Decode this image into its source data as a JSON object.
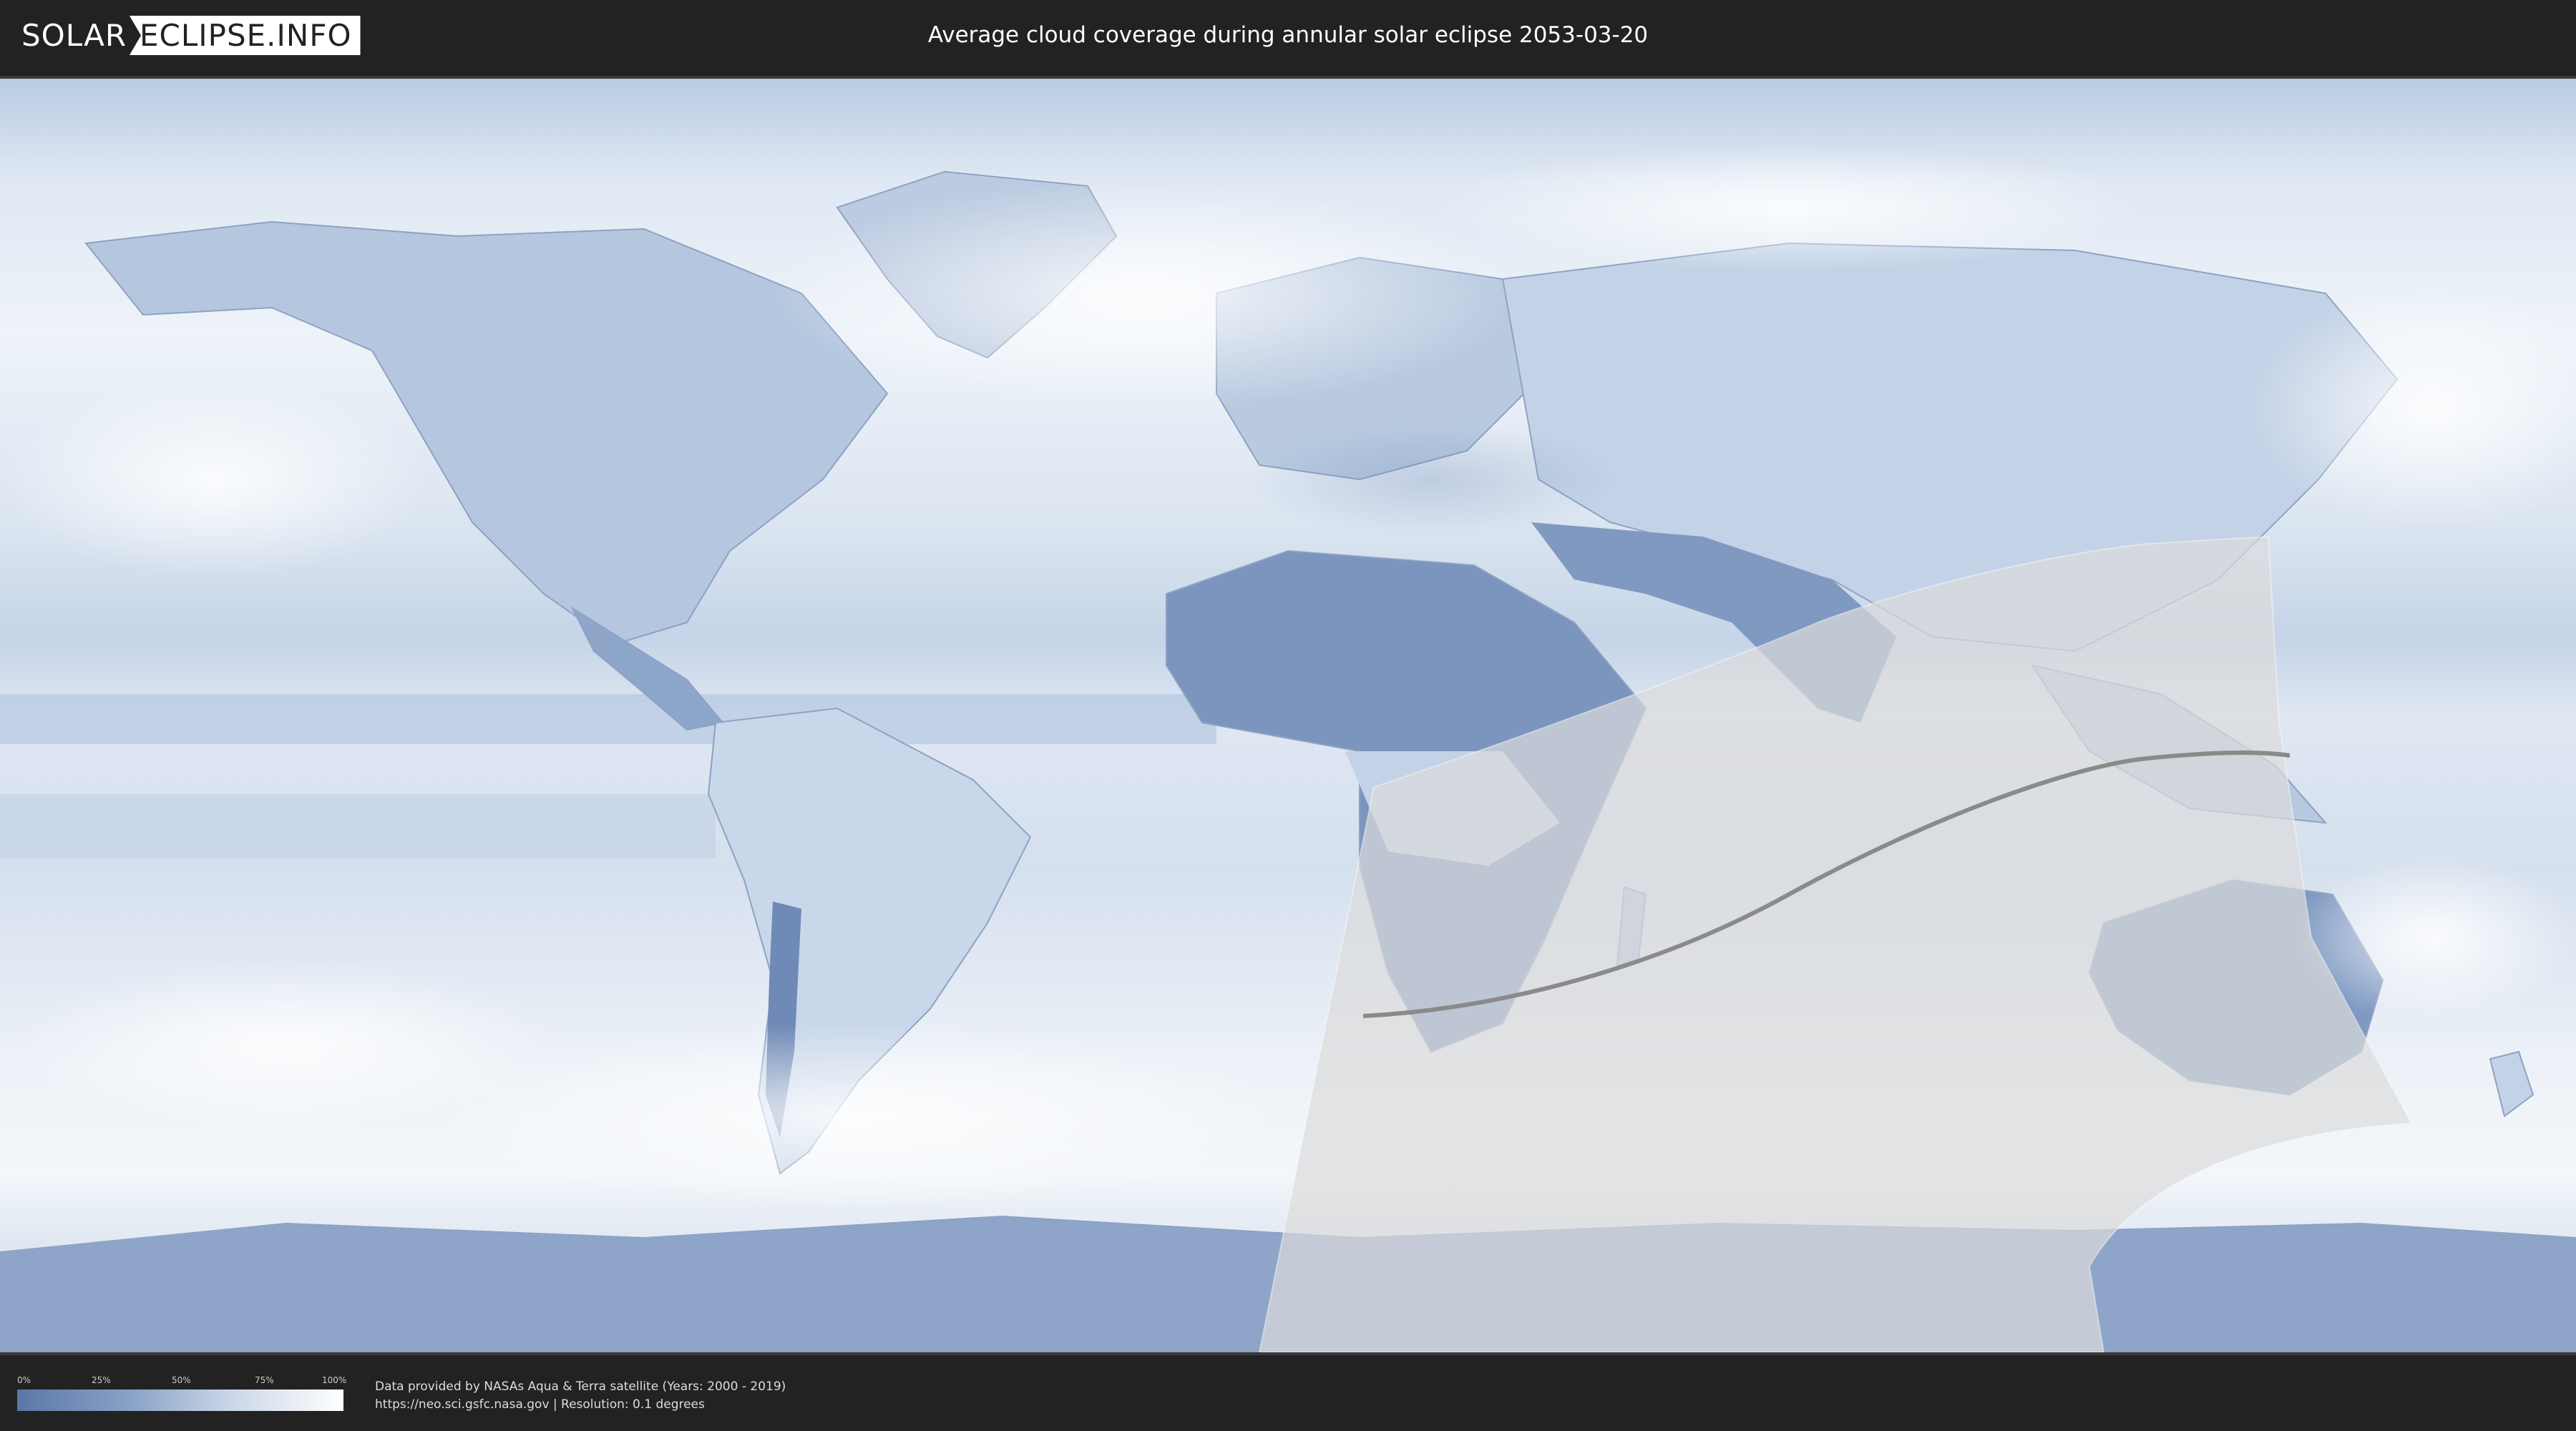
{
  "header": {
    "logo_left": "SOLAR",
    "logo_right": "ECLIPSE.INFO",
    "title": "Average cloud coverage during annular solar eclipse 2053-03-20"
  },
  "legend": {
    "labels": [
      "0%",
      "25%",
      "50%",
      "75%",
      "100%"
    ],
    "gradient_colors": [
      "#5a77a8",
      "#8aa2c6",
      "#c9d6e7",
      "#ffffff"
    ]
  },
  "credits": {
    "line1": "Data provided by NASAs Aqua & Terra satellite (Years: 2000 - 2019)",
    "line2": "https://neo.sci.gsfc.nasa.gov | Resolution: 0.1 degrees"
  },
  "colors": {
    "background": "#222222",
    "cloud_low": "#6f8cb8",
    "cloud_high": "#f4f7fb",
    "eclipse_overlay": "#dcdcdc",
    "central_line": "#8a8a8a"
  }
}
